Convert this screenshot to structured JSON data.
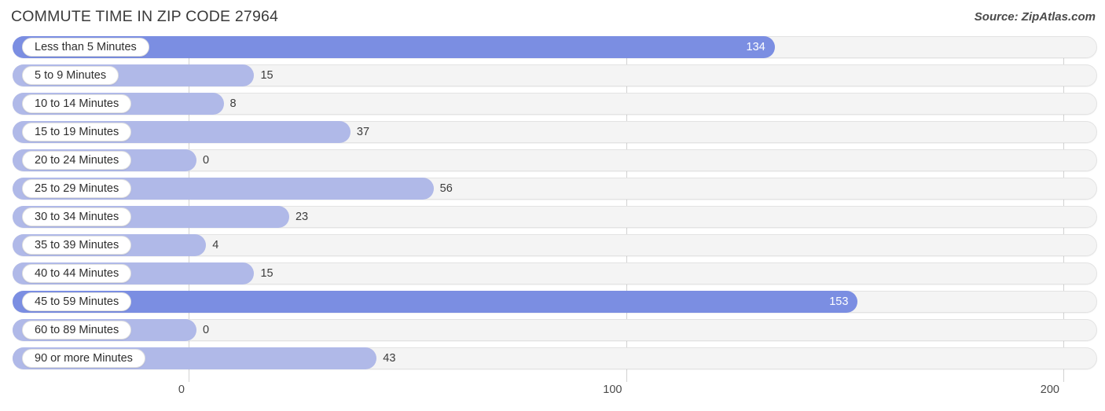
{
  "header": {
    "title": "COMMUTE TIME IN ZIP CODE 27964",
    "source": "Source: ZipAtlas.com"
  },
  "colors": {
    "bar_light": "#b0b9e8",
    "bar_dark": "#7b8ee2",
    "track": "#f4f4f4",
    "gridline": "#d2d2d2",
    "text": "#3c3c3c",
    "value_inside": "#ffffff"
  },
  "axis": {
    "ticks": [
      "0",
      "100",
      "200"
    ],
    "tick_values": [
      0,
      100,
      200
    ],
    "min": 0,
    "max": 200
  },
  "chart_data": {
    "type": "bar",
    "orientation": "horizontal",
    "title": "COMMUTE TIME IN ZIP CODE 27964",
    "subtitle": "Source: ZipAtlas.com",
    "xlabel": "",
    "ylabel": "",
    "xlim": [
      0,
      200
    ],
    "grid": true,
    "legend": "none",
    "categories": [
      "Less than 5 Minutes",
      "5 to 9 Minutes",
      "10 to 14 Minutes",
      "15 to 19 Minutes",
      "20 to 24 Minutes",
      "25 to 29 Minutes",
      "30 to 34 Minutes",
      "35 to 39 Minutes",
      "40 to 44 Minutes",
      "45 to 59 Minutes",
      "60 to 89 Minutes",
      "90 or more Minutes"
    ],
    "values": [
      134,
      15,
      8,
      37,
      0,
      56,
      23,
      4,
      15,
      153,
      0,
      43
    ],
    "value_labels": [
      "134",
      "15",
      "8",
      "37",
      "0",
      "56",
      "23",
      "4",
      "15",
      "153",
      "0",
      "43"
    ]
  },
  "rows": [
    {
      "label": "Less than 5 Minutes",
      "value": 134,
      "value_label": "134",
      "highlight": true
    },
    {
      "label": "5 to 9 Minutes",
      "value": 15,
      "value_label": "15",
      "highlight": false
    },
    {
      "label": "10 to 14 Minutes",
      "value": 8,
      "value_label": "8",
      "highlight": false
    },
    {
      "label": "15 to 19 Minutes",
      "value": 37,
      "value_label": "37",
      "highlight": false
    },
    {
      "label": "20 to 24 Minutes",
      "value": 0,
      "value_label": "0",
      "highlight": false
    },
    {
      "label": "25 to 29 Minutes",
      "value": 56,
      "value_label": "56",
      "highlight": false
    },
    {
      "label": "30 to 34 Minutes",
      "value": 23,
      "value_label": "23",
      "highlight": false
    },
    {
      "label": "35 to 39 Minutes",
      "value": 4,
      "value_label": "4",
      "highlight": false
    },
    {
      "label": "40 to 44 Minutes",
      "value": 15,
      "value_label": "15",
      "highlight": false
    },
    {
      "label": "45 to 59 Minutes",
      "value": 153,
      "value_label": "153",
      "highlight": true
    },
    {
      "label": "60 to 89 Minutes",
      "value": 0,
      "value_label": "0",
      "highlight": false
    },
    {
      "label": "90 or more Minutes",
      "value": 43,
      "value_label": "43",
      "highlight": false
    }
  ]
}
